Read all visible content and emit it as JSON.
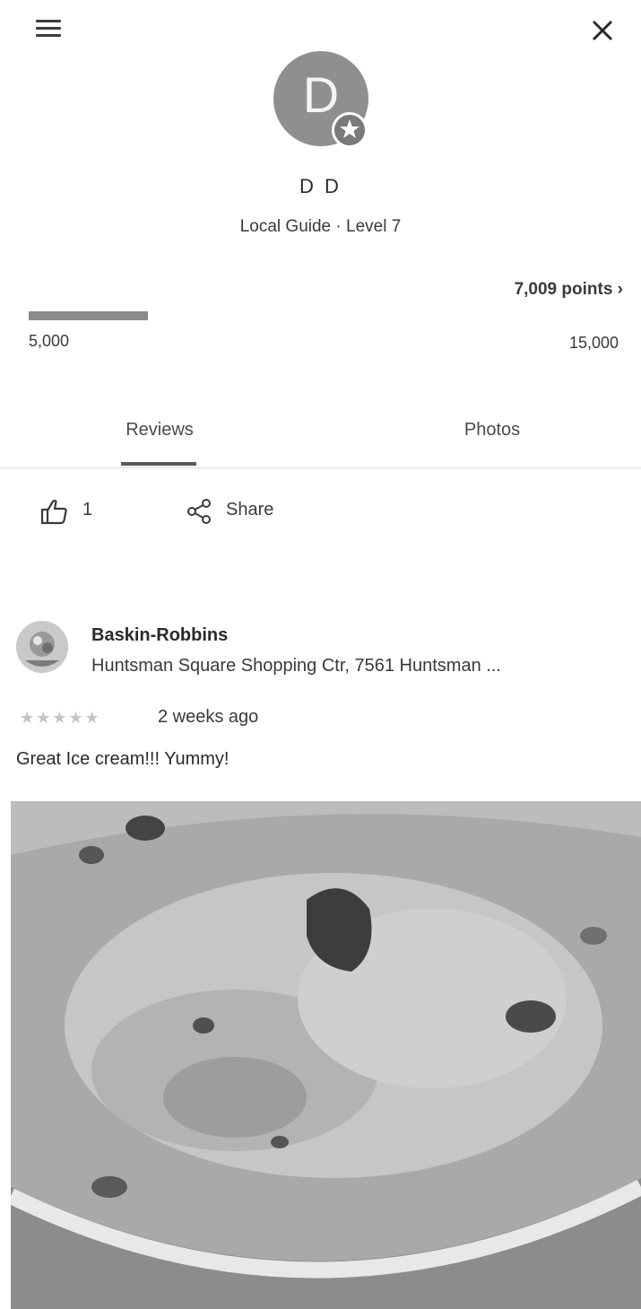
{
  "header": {
    "menu_icon": "hamburger-menu-icon",
    "close_icon": "close-icon"
  },
  "profile": {
    "avatar_letter": "D",
    "name": "D D",
    "level": "Local Guide · Level 7",
    "badge_icon": "local-guide-star-badge-icon"
  },
  "points": {
    "link_label": "7,009 points ›",
    "min_label": "5,000",
    "max_label": "15,000",
    "progress_fraction": 0.2009
  },
  "tabs": [
    {
      "label": "Reviews",
      "active": true
    },
    {
      "label": "Photos",
      "active": false
    }
  ],
  "actions": {
    "like_count": "1",
    "share_label": "Share",
    "like_icon": "thumbs-up-icon",
    "share_icon": "share-icon"
  },
  "review": {
    "place_name": "Baskin-Robbins",
    "place_address": "Huntsman Square Shopping Ctr, 7561 Huntsman ...",
    "stars": "★★★★★",
    "rating": 5,
    "date": "2 weeks ago",
    "text": "Great Ice cream!!! Yummy!",
    "photo_alt": "ice-cream-photo"
  },
  "colors": {
    "text": "#202124",
    "muted": "#3a3a3a",
    "avatar_bg": "#8f8f8f",
    "progress_fill": "#8a8a8a"
  }
}
